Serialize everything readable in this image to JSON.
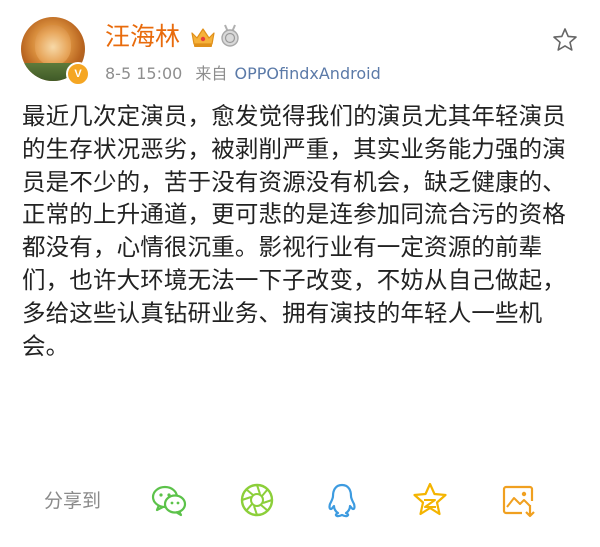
{
  "post": {
    "author": "汪海林",
    "date": "8-5 15:00",
    "source_prefix": "来自",
    "source": "OPPOfindxAndroid",
    "verified_badge": "V",
    "text": "最近几次定演员，愈发觉得我们的演员尤其年轻演员的生存状况恶劣，被剥削严重，其实业务能力强的演员是不少的，苦于没有资源没有机会，缺乏健康的、正常的上升通道，更可悲的是连参加同流合污的资格都没有，心情很沉重。影视行业有一定资源的前辈们，也许大环境无法一下子改变，不妨从自己做起，多给这些认真钻研业务、拥有演技的年轻人一些机会。"
  },
  "share": {
    "label": "分享到",
    "targets": [
      {
        "name": "wechat-icon",
        "color": "#5cc24a"
      },
      {
        "name": "moments-icon",
        "color": "#8ccf3a"
      },
      {
        "name": "qq-icon",
        "color": "#3d9be0"
      },
      {
        "name": "qzone-icon",
        "color": "#f4b400"
      },
      {
        "name": "save-image-icon",
        "color": "#f0a020"
      }
    ]
  },
  "colors": {
    "author": "#e86b0c",
    "meta": "#8e8e8e",
    "link": "#5b7aa8",
    "body_text": "#222222"
  }
}
